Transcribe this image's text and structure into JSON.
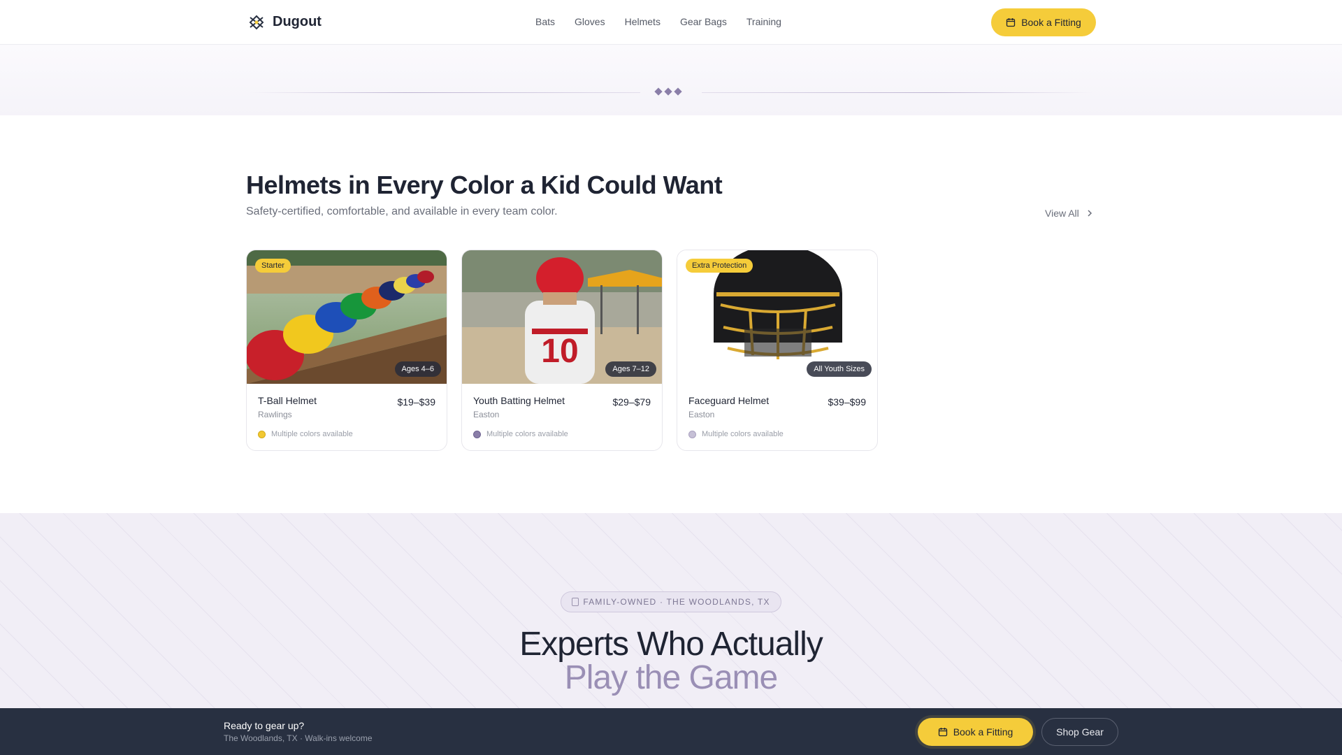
{
  "header": {
    "brand": "Dugout",
    "nav": [
      "Bats",
      "Gloves",
      "Helmets",
      "Gear Bags",
      "Training"
    ],
    "cta": "Book a Fitting"
  },
  "section": {
    "title": "Helmets in Every Color a Kid Could Want",
    "subtitle": "Safety-certified, comfortable, and available in every team color.",
    "view_all": "View All"
  },
  "products": [
    {
      "badge": "Starter",
      "ages": "Ages 4–6",
      "name": "T-Ball Helmet",
      "brand": "Rawlings",
      "price": "$19–$39",
      "colors_note": "Multiple colors available",
      "swatch": "#f2c832"
    },
    {
      "badge": "",
      "ages": "Ages 7–12",
      "name": "Youth Batting Helmet",
      "brand": "Easton",
      "price": "$29–$79",
      "colors_note": "Multiple colors available",
      "swatch": "#8a7ea8"
    },
    {
      "badge": "Extra Protection",
      "ages": "All Youth Sizes",
      "name": "Faceguard Helmet",
      "brand": "Easton",
      "price": "$39–$99",
      "colors_note": "Multiple colors available",
      "swatch": "#c6c0d6"
    }
  ],
  "about": {
    "pill": "FAMILY-OWNED · THE WOODLANDS, TX",
    "headline_1": "Experts Who Actually",
    "headline_2": "Play the Game"
  },
  "footer_bar": {
    "title": "Ready to gear up?",
    "subtitle": "The Woodlands, TX · Walk-ins welcome",
    "cta_primary": "Book a Fitting",
    "cta_secondary": "Shop Gear"
  },
  "colors": {
    "accent_yellow": "#f5cc3a",
    "accent_purple": "#9a8fb5",
    "dark": "#283041"
  }
}
